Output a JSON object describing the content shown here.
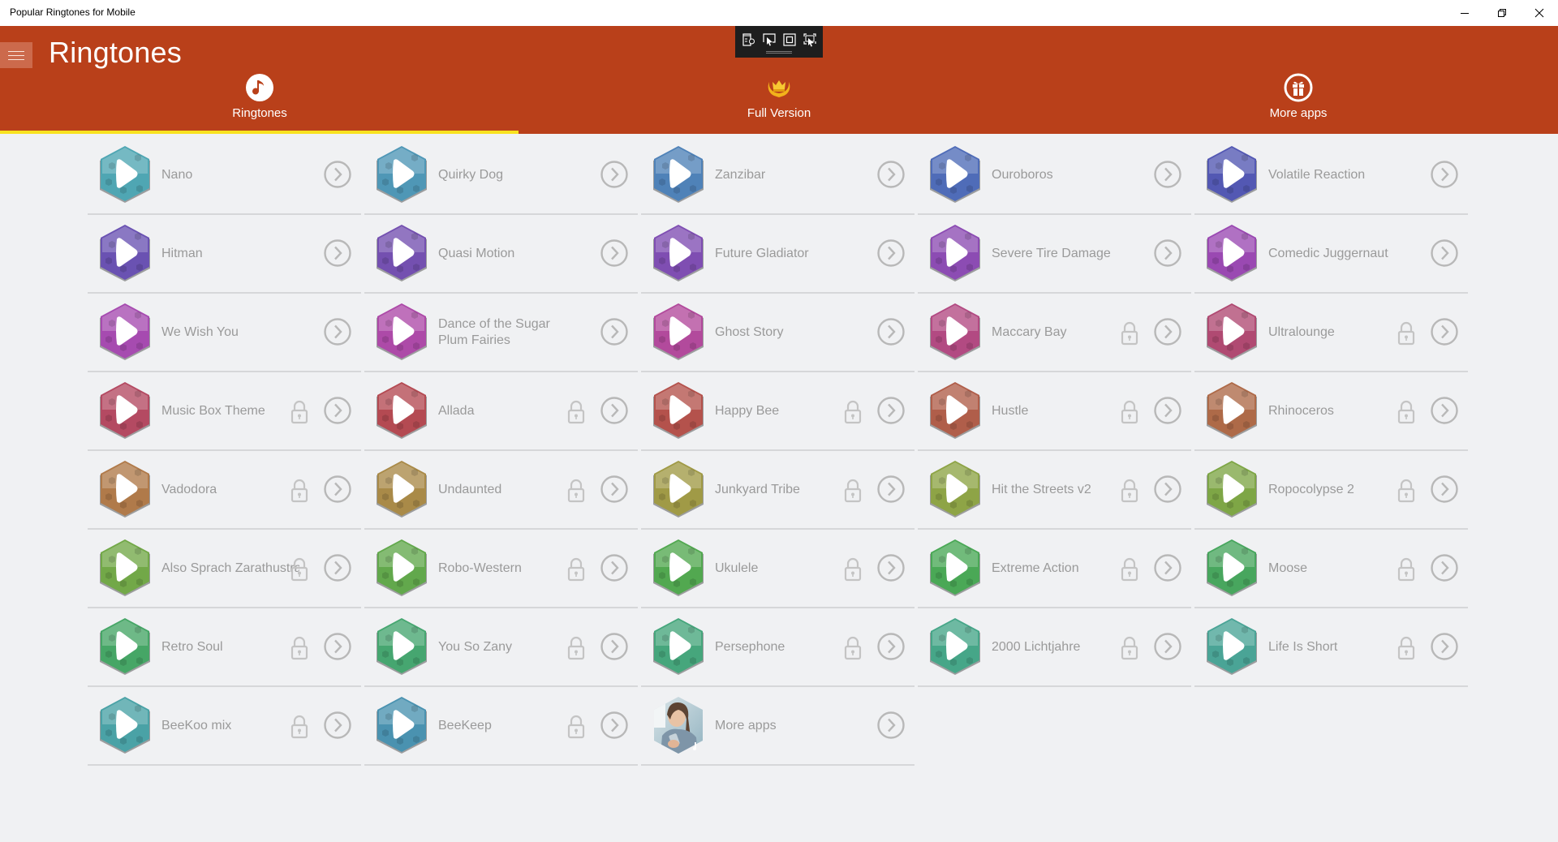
{
  "window": {
    "title": "Popular Ringtones for Mobile",
    "controls": [
      "minimize-icon",
      "restore-icon",
      "close-icon"
    ]
  },
  "header": {
    "app_title": "Ringtones",
    "menu_icon": "hamburger-icon",
    "accent_color": "#b9401a",
    "active_tab_indicator_color": "#f8e21f"
  },
  "dev_toolbar": {
    "buttons": [
      "live-visual-tree-icon",
      "select-element-icon",
      "display-layout-adorners-icon",
      "track-focus-icon"
    ]
  },
  "tabs": [
    {
      "label": "Ringtones",
      "icon": "music-note-icon",
      "active": true
    },
    {
      "label": "Full Version",
      "icon": "crown-laurel-icon",
      "active": false
    },
    {
      "label": "More apps",
      "icon": "gift-icon",
      "active": false
    }
  ],
  "ringtones": [
    {
      "name": "Nano",
      "locked": false,
      "color": "#4fa6b3"
    },
    {
      "name": "Quirky Dog",
      "locked": false,
      "color": "#4f97b6"
    },
    {
      "name": "Zanzibar",
      "locked": false,
      "color": "#4f82b8"
    },
    {
      "name": "Ouroboros",
      "locked": false,
      "color": "#4f6cb8"
    },
    {
      "name": "Volatile Reaction",
      "locked": false,
      "color": "#5358b3"
    },
    {
      "name": "Hitman",
      "locked": false,
      "color": "#6a52b2"
    },
    {
      "name": "Quasi Motion",
      "locked": false,
      "color": "#7450b0"
    },
    {
      "name": "Future Gladiator",
      "locked": false,
      "color": "#7f4eb2"
    },
    {
      "name": "Severe Tire Damage",
      "locked": false,
      "color": "#8c4cb3"
    },
    {
      "name": "Comedic Juggernaut",
      "locked": false,
      "color": "#9a49b2"
    },
    {
      "name": "We Wish You",
      "locked": false,
      "color": "#a64bb0"
    },
    {
      "name": "Dance of the Sugar Plum Fairies",
      "locked": false,
      "color": "#ad4aa8"
    },
    {
      "name": "Ghost Story",
      "locked": false,
      "color": "#b24a9c"
    },
    {
      "name": "Maccary Bay",
      "locked": true,
      "color": "#b24a82"
    },
    {
      "name": "Ultralounge",
      "locked": true,
      "color": "#b04a72"
    },
    {
      "name": "Music Box Theme",
      "locked": true,
      "color": "#b44a62"
    },
    {
      "name": "Allada",
      "locked": true,
      "color": "#b44a52"
    },
    {
      "name": "Happy Bee",
      "locked": true,
      "color": "#b4524c"
    },
    {
      "name": "Hustle",
      "locked": true,
      "color": "#b05e4a"
    },
    {
      "name": "Rhinoceros",
      "locked": true,
      "color": "#ae6a48"
    },
    {
      "name": "Vadodora",
      "locked": true,
      "color": "#b07a4a"
    },
    {
      "name": "Undaunted",
      "locked": true,
      "color": "#a98a48"
    },
    {
      "name": "Junkyard Tribe",
      "locked": true,
      "color": "#a09a46"
    },
    {
      "name": "Hit the Streets v2",
      "locked": true,
      "color": "#8ea446"
    },
    {
      "name": "Ropocolypse 2",
      "locked": true,
      "color": "#7ea646"
    },
    {
      "name": "Also Sprach Zarathustra",
      "locked": true,
      "color": "#72a848"
    },
    {
      "name": "Robo-Western",
      "locked": true,
      "color": "#62a84c"
    },
    {
      "name": "Ukulele",
      "locked": true,
      "color": "#52a850"
    },
    {
      "name": "Extreme Action",
      "locked": true,
      "color": "#4aa856"
    },
    {
      "name": "Moose",
      "locked": true,
      "color": "#48a65e"
    },
    {
      "name": "Retro Soul",
      "locked": true,
      "color": "#46a666"
    },
    {
      "name": "You So Zany",
      "locked": true,
      "color": "#46a670"
    },
    {
      "name": "Persephone",
      "locked": true,
      "color": "#46a67c"
    },
    {
      "name": "2000 Lichtjahre",
      "locked": true,
      "color": "#46a688"
    },
    {
      "name": "Life Is Short",
      "locked": true,
      "color": "#4aa496"
    },
    {
      "name": "BeeKoo mix",
      "locked": true,
      "color": "#4aa2a6"
    },
    {
      "name": "BeeKeep",
      "locked": true,
      "color": "#4a92b0"
    }
  ],
  "more_apps_item": {
    "name": "More apps",
    "icon": "person-photo-icon"
  }
}
